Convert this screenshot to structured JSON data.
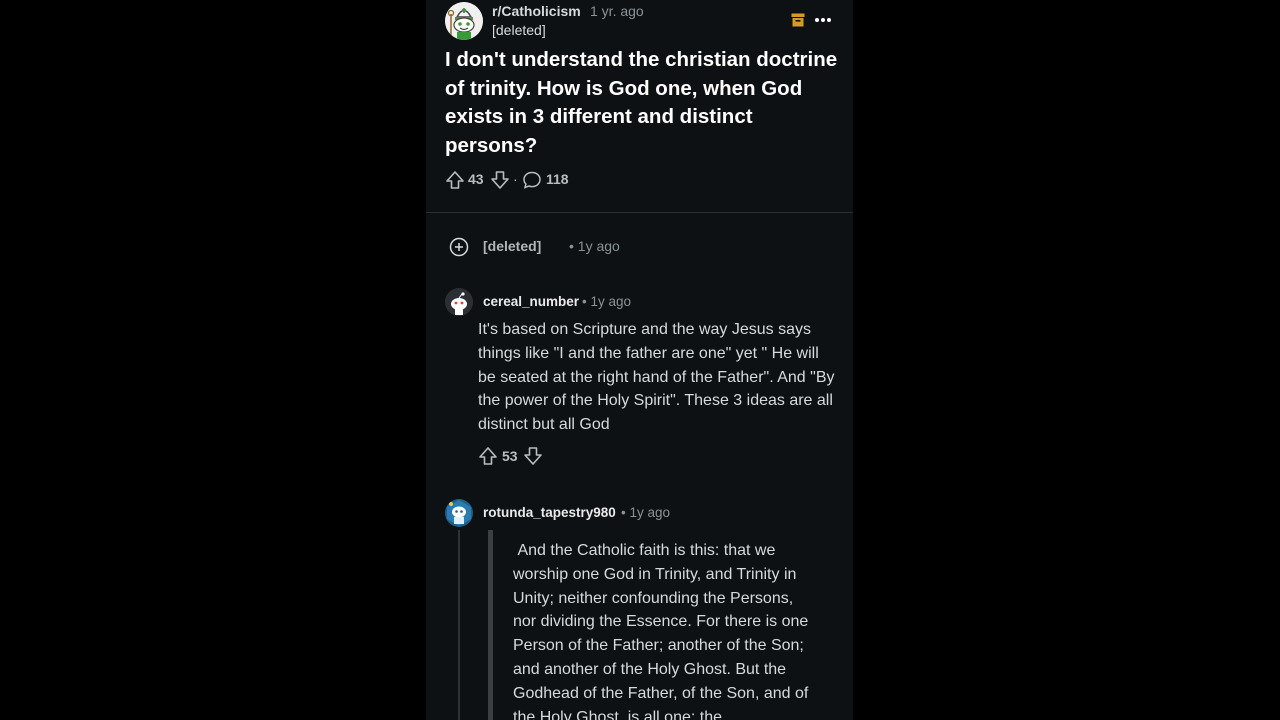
{
  "post": {
    "subreddit": "r/Catholicism",
    "time": "1 yr. ago",
    "author": "[deleted]",
    "title": "I don't understand the christian doctrine of trinity. How is God one, when God exists in 3 different and distinct persons?",
    "upvotes": "43",
    "comments": "118",
    "separator": "·"
  },
  "collapsed_comment": {
    "user": "[deleted]",
    "time": "• 1y ago"
  },
  "comment1": {
    "user": "cereal_number",
    "time": "• 1y ago",
    "body": "It's based on Scripture and the way Jesus says things like \"I and the father are one\" yet \" He will be seated at the right hand of the Father\". And \"By the power of the Holy Spirit\". These 3 ideas are all distinct but all God",
    "score": "53"
  },
  "comment2": {
    "user": "rotunda_tapestry980",
    "time": "• 1y ago",
    "quote": " And the Catholic faith is this: that we worship one God in Trinity, and Trinity in Unity; neither confounding the Persons, nor dividing the Essence. For there is one Person of the Father; another of the Son; and another of the Holy Ghost. But the Godhead of the Father, of the Son, and of the Holy Ghost, is all one; the"
  },
  "colors": {
    "background": "#0e1113",
    "archive_accent": "#d69a2b"
  },
  "icons": [
    "snoo-bishop-avatar",
    "archive-icon",
    "more-icon",
    "upvote-icon",
    "downvote-icon",
    "comment-icon",
    "expand-plus-icon",
    "snoo-avatar"
  ]
}
